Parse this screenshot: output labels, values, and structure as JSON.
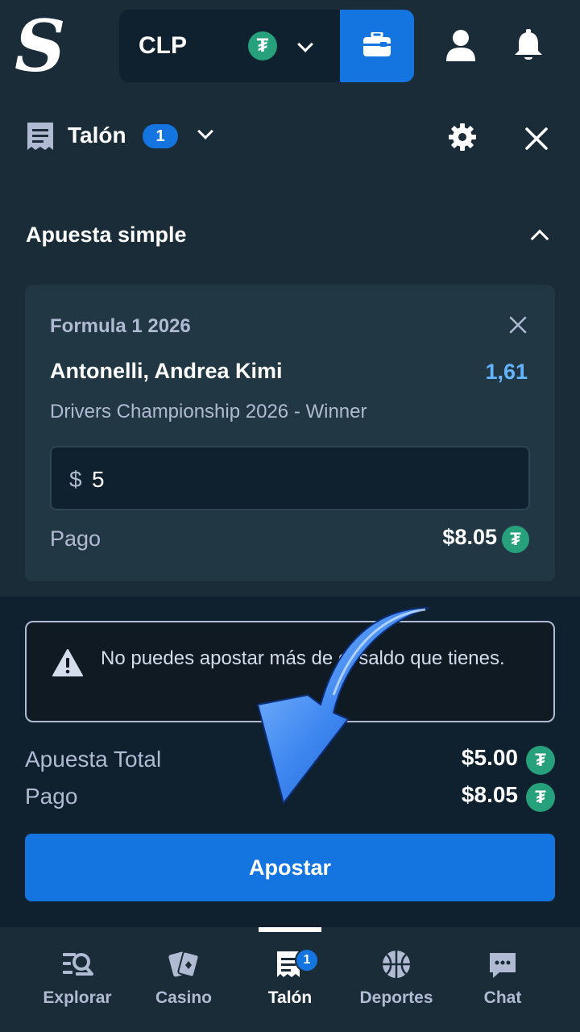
{
  "topbar": {
    "logo_letter": "S",
    "currency": "CLP",
    "tether_symbol": "₮"
  },
  "slip": {
    "title": "Talón",
    "count": "1"
  },
  "main": {
    "section_title": "Apuesta simple",
    "bet": {
      "event": "Formula 1 2026",
      "selection": "Antonelli, Andrea Kimi",
      "odds": "1,61",
      "market": "Drivers Championship 2026 - Winner",
      "stake_prefix": "$",
      "stake_value": "5",
      "payout_label": "Pago",
      "payout_value": "$8.05"
    }
  },
  "summary": {
    "warning": "No puedes apostar más de el saldo que tienes.",
    "total_label": "Apuesta Total",
    "total_value": "$5.00",
    "payout_label": "Pago",
    "payout_value": "$8.05",
    "button_label": "Apostar"
  },
  "nav": {
    "items": [
      {
        "label": "Explorar"
      },
      {
        "label": "Casino"
      },
      {
        "label": "Talón",
        "badge": "1"
      },
      {
        "label": "Deportes"
      },
      {
        "label": "Chat"
      }
    ]
  },
  "colors": {
    "accent": "#1475e1",
    "odds": "#64b4ff",
    "tether": "#26a17b",
    "panel": "#1a2c38",
    "card": "#213743",
    "dark": "#0f212e"
  }
}
